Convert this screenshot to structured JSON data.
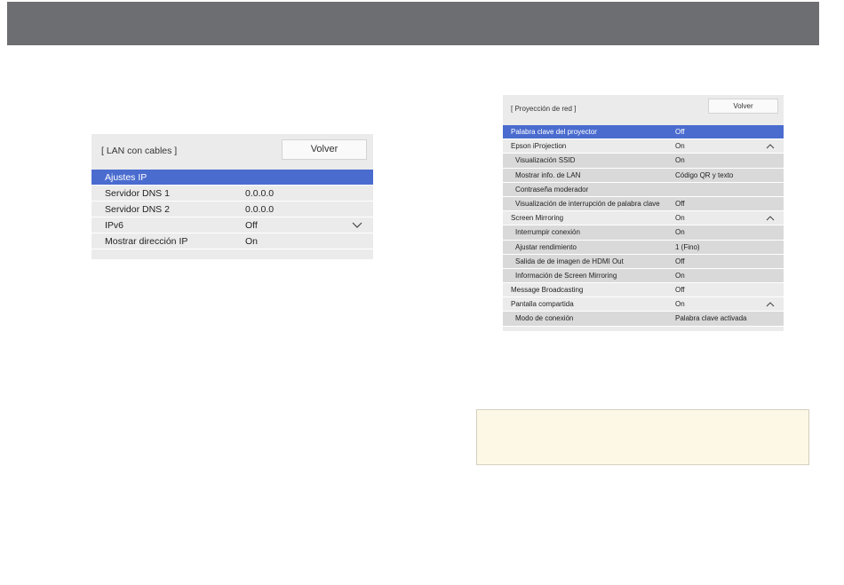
{
  "lan_panel": {
    "title": "[ LAN con cables ]",
    "back_label": "Volver",
    "rows": [
      {
        "label": "Ajustes IP",
        "value": "",
        "selected": true
      },
      {
        "label": "Servidor DNS 1",
        "value": "0.0.0.0"
      },
      {
        "label": "Servidor DNS 2",
        "value": "0.0.0.0"
      },
      {
        "label": "IPv6",
        "value": "Off",
        "icon": "chevron-down-icon"
      },
      {
        "label": "Mostrar dirección IP",
        "value": "On"
      }
    ]
  },
  "network_projection_panel": {
    "title": "[ Proyección de red ]",
    "back_label": "Volver",
    "rows": [
      {
        "label": "Palabra clave del proyector",
        "value": "Off",
        "selected": true
      },
      {
        "label": "Epson iProjection",
        "value": "On",
        "icon": "chevron-up-icon"
      },
      {
        "label": "Visualización SSID",
        "value": "On",
        "sub": true
      },
      {
        "label": "Mostrar info. de LAN",
        "value": "Código QR y texto",
        "sub": true
      },
      {
        "label": "Contraseña moderador",
        "value": "",
        "sub": true
      },
      {
        "label": "Visualización de interrupción de palabra clave",
        "value": "Off",
        "sub": true
      },
      {
        "label": "Screen Mirroring",
        "value": "On",
        "icon": "chevron-up-icon"
      },
      {
        "label": "Interrumpir conexión",
        "value": "On",
        "sub": true
      },
      {
        "label": "Ajustar rendimiento",
        "value": "1 (Fino)",
        "sub": true
      },
      {
        "label": "Salida de de imagen de HDMI Out",
        "value": "Off",
        "sub": true
      },
      {
        "label": "Información de Screen Mirroring",
        "value": "On",
        "sub": true
      },
      {
        "label": "Message Broadcasting",
        "value": "Off"
      },
      {
        "label": "Pantalla compartida",
        "value": "On",
        "icon": "chevron-up-icon"
      },
      {
        "label": "Modo de conexión",
        "value": "Palabra clave activada",
        "sub": true
      }
    ]
  },
  "colors": {
    "header_bar": "#6d6e71",
    "panel_bg": "#ebebeb",
    "sub_row_bg": "#d9d9d9",
    "selected_row": "#4a6ccf",
    "note_bg": "#fdf8e6"
  }
}
